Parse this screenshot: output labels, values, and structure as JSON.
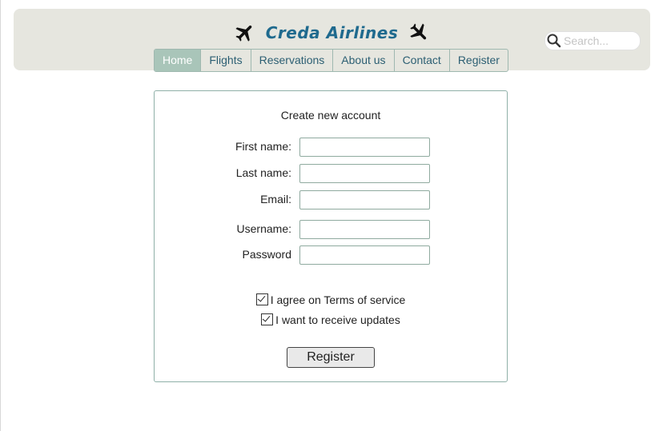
{
  "header": {
    "title": "Creda Airlines",
    "left_icon": "airplane-icon",
    "right_icon": "airplane-icon",
    "brand_color": "#1f6a8e"
  },
  "search": {
    "placeholder": "Search...",
    "value": "",
    "icon": "search-icon"
  },
  "nav": {
    "items": [
      {
        "label": "Home",
        "active": true
      },
      {
        "label": "Flights",
        "active": false
      },
      {
        "label": "Reservations",
        "active": false
      },
      {
        "label": "About us",
        "active": false
      },
      {
        "label": "Contact",
        "active": false
      },
      {
        "label": "Register",
        "active": false
      }
    ],
    "active_color": "#a9c5b9"
  },
  "form": {
    "title": "Create new account",
    "fields": {
      "first_name": {
        "label": "First name:",
        "value": ""
      },
      "last_name": {
        "label": "Last name:",
        "value": ""
      },
      "email": {
        "label": "Email:",
        "value": ""
      },
      "username": {
        "label": "Username:",
        "value": ""
      },
      "password": {
        "label": "Password",
        "value": ""
      }
    },
    "checkboxes": {
      "terms": {
        "label": "I agree on Terms of service",
        "checked": true
      },
      "updates": {
        "label": "I want to receive updates",
        "checked": true
      }
    },
    "submit_label": "Register"
  }
}
